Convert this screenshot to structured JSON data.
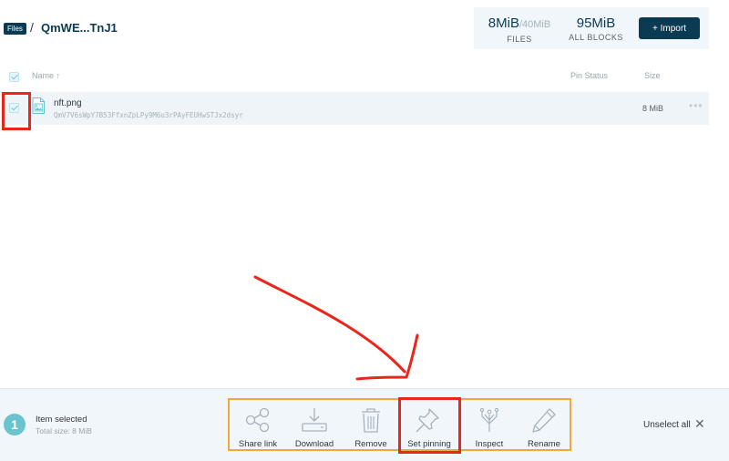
{
  "breadcrumb": {
    "root": "Files",
    "separator": "/",
    "current": "QmWE...TnJ1"
  },
  "stats": {
    "files_value": "8MiB",
    "files_capacity": "/40MiB",
    "files_label": "FILES",
    "blocks_value": "95MiB",
    "blocks_label": "ALL BLOCKS"
  },
  "import_label": "+ Import",
  "table": {
    "headers": {
      "name": "Name ↑",
      "pin_status": "Pin Status",
      "size": "Size"
    },
    "rows": [
      {
        "name": "nft.png",
        "hash": "QmV7V6sWpY7B53FfxnZpLPy9M6u3rPAyFEUHwSTJx2dsyr",
        "size": "8 MiB",
        "more": "•••"
      }
    ]
  },
  "selection": {
    "count": "1",
    "text": "Item selected",
    "total": "Total size: 8 MiB"
  },
  "actions": [
    {
      "label": "Share link",
      "icon": "share-icon"
    },
    {
      "label": "Download",
      "icon": "download-icon"
    },
    {
      "label": "Remove",
      "icon": "trash-icon"
    },
    {
      "label": "Set pinning",
      "icon": "pin-icon"
    },
    {
      "label": "Inspect",
      "icon": "inspect-icon"
    },
    {
      "label": "Rename",
      "icon": "pencil-icon"
    }
  ],
  "unselect_label": "Unselect all",
  "close_glyph": "✕",
  "colors": {
    "navy": "#0b3a53",
    "teal": "#69c4cd",
    "annotation_red": "#e8261b",
    "highlight_orange": "#f0a83a"
  }
}
